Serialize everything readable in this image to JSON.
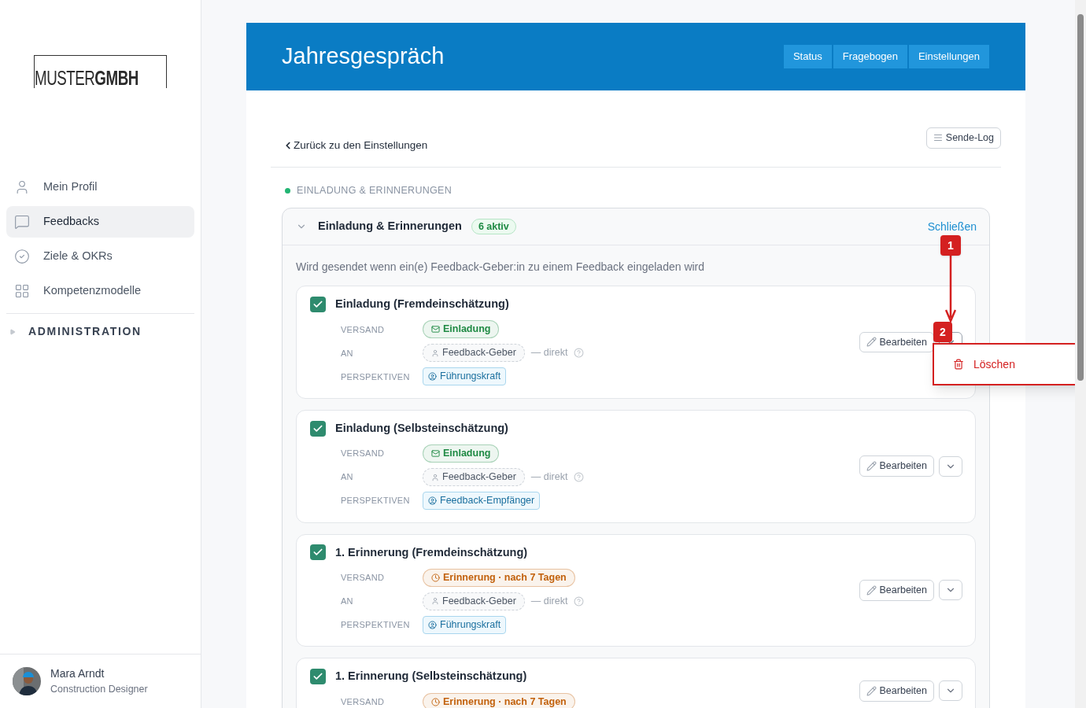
{
  "logo": {
    "light": "MUSTER",
    "bold": "GMBH"
  },
  "nav": [
    {
      "label": "Mein Profil",
      "selected": false
    },
    {
      "label": "Feedbacks",
      "selected": true
    },
    {
      "label": "Ziele & OKRs",
      "selected": false
    },
    {
      "label": "Kompetenzmodelle",
      "selected": false
    }
  ],
  "admin": {
    "label": "ADMINISTRATION",
    "expanded": false
  },
  "user": {
    "name": "Mara Arndt",
    "role": "Construction Designer"
  },
  "header": {
    "title": "Jahresgespräch",
    "buttons": [
      "Status",
      "Fragebogen",
      "Einstellungen"
    ]
  },
  "back_link": "Zurück zu den Einstellungen",
  "send_log": "Sende-Log",
  "section_label": "EINLADUNG & ERINNERUNGEN",
  "accordion": {
    "title": "Einladung & Erinnerungen",
    "badge": "6 aktiv",
    "expanded": true,
    "action": "Schließen",
    "description": "Wird gesendet wenn ein(e) Feedback-Geber:in zu einem Feedback eingeladen wird"
  },
  "cards": [
    {
      "title": "Einladung (Fremdeinschätzung)",
      "checked": true,
      "edit": "Bearbeiten",
      "menu_open": true,
      "rows": [
        {
          "kind": "dispatch",
          "label": "VERSAND",
          "color": "#1f8a44",
          "value": "Einladung"
        },
        {
          "kind": "recipient",
          "label": "AN",
          "value": "Feedback-Geber",
          "note": "— direkt"
        },
        {
          "kind": "perspective",
          "label": "PERSPEKTIVEN",
          "value": "Führungskraft"
        }
      ]
    },
    {
      "title": "Einladung (Selbsteinschätzung)",
      "checked": true,
      "edit": "Bearbeiten",
      "menu_open": false,
      "rows": [
        {
          "kind": "dispatch",
          "label": "VERSAND",
          "color": "#1f8a44",
          "value": "Einladung"
        },
        {
          "kind": "recipient",
          "label": "AN",
          "value": "Feedback-Geber",
          "note": "— direkt"
        },
        {
          "kind": "perspective",
          "label": "PERSPEKTIVEN",
          "value": "Feedback-Empfänger"
        }
      ]
    },
    {
      "title": "1. Erinnerung (Fremdeinschätzung)",
      "checked": true,
      "edit": "Bearbeiten",
      "menu_open": false,
      "rows": [
        {
          "kind": "dispatch",
          "label": "VERSAND",
          "color": "#c2610c",
          "value": "Erinnerung · nach 7 Tagen"
        },
        {
          "kind": "recipient",
          "label": "AN",
          "value": "Feedback-Geber",
          "note": "— direkt"
        },
        {
          "kind": "perspective",
          "label": "PERSPEKTIVEN",
          "value": "Führungskraft"
        }
      ]
    },
    {
      "title": "1. Erinnerung (Selbsteinschätzung)",
      "checked": true,
      "edit": "Bearbeiten",
      "menu_open": false,
      "rows": [
        {
          "kind": "dispatch",
          "label": "VERSAND",
          "color": "#c2610c",
          "value": "Erinnerung · nach 7 Tagen"
        }
      ]
    }
  ],
  "menu": {
    "items": [
      "Löschen"
    ]
  },
  "annotations": [
    "1",
    "2"
  ]
}
